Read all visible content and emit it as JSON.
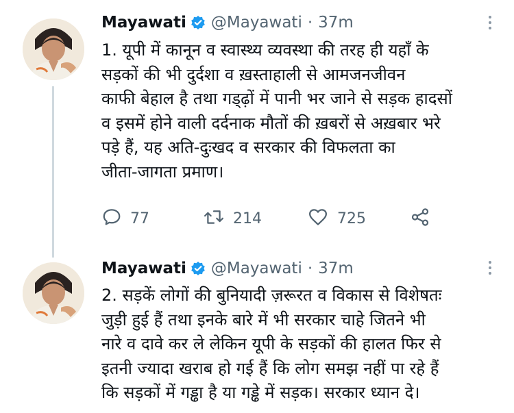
{
  "tweets": [
    {
      "author": "Mayawati",
      "handle": "@Mayawati",
      "separator": "·",
      "time": "37m",
      "text": "1. यूपी में कानून व स्वास्थ्य व्यवस्था की तरह ही यहाँ के\nसड़कों की भी दुर्दशा व ख़स्ताहाली से आमजनजीवन\nकाफी बेहाल है तथा गड्ढ़ों में पानी भर जाने से सड़क हादसों\nव इसमें होने वाली दर्दनाक मौतों की ख़बरों से अख़बार भरे\nपड़े हैं, यह अति-दुःखद व सरकार की विफलता का\nजीता-जागता प्रमाण।",
      "replies": "77",
      "retweets": "214",
      "likes": "725"
    },
    {
      "author": "Mayawati",
      "handle": "@Mayawati",
      "separator": "·",
      "time": "37m",
      "text": "2. सड़कें लोगों की बुनियादी ज़रूरत व विकास से विशेषतः\nजुड़ी हुई हैं तथा इनके बारे में भी सरकार चाहे जितने भी\nनारे व दावे कर ले लेकिन यूपी के सड़कों की हालत फिर से\nइतनी ज्यादा खराब हो गई हैं कि लोग समझ नहीं पा रहे हैं\nकि सड़कों में गड्ढा है या गड्ढे में सड़क। सरकार ध्यान दे।"
    }
  ],
  "icons": {
    "verified": "verified-badge-icon",
    "more": "more-options-icon",
    "reply": "reply-icon",
    "retweet": "retweet-icon",
    "like": "like-icon",
    "share": "share-icon"
  },
  "colors": {
    "verified": "#1d9bf0",
    "secondary_text": "#536471",
    "thread_line": "#cfd9de"
  }
}
